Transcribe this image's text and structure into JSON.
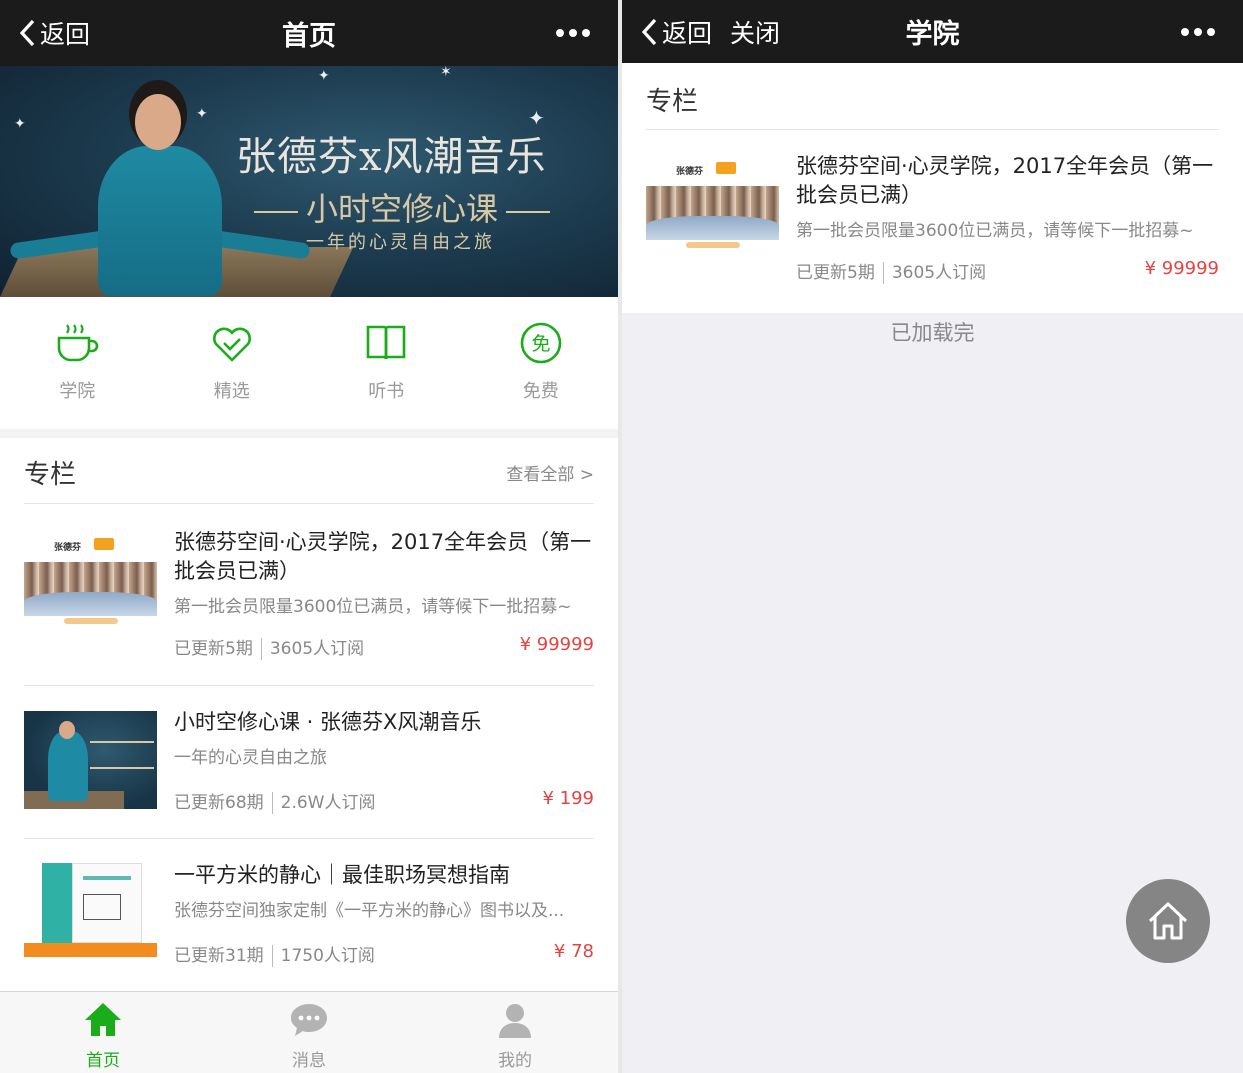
{
  "left": {
    "navbar": {
      "back_label": "返回",
      "title": "首页"
    },
    "banner": {
      "title": "张德芬x风潮音乐",
      "subtitle": "小时空修心课",
      "tagline": "一年的心灵自由之旅"
    },
    "quick_nav": [
      {
        "label": "学院",
        "icon": "teacup-icon"
      },
      {
        "label": "精选",
        "icon": "heart-check-icon"
      },
      {
        "label": "听书",
        "icon": "book-icon"
      },
      {
        "label": "免费",
        "icon": "free-icon",
        "glyph": "免"
      }
    ],
    "section": {
      "title": "专栏",
      "more_label": "查看全部 >",
      "items": [
        {
          "title": "张德芬空间·心灵学院，2017全年会员（第一批会员已满）",
          "desc": "第一批会员限量3600位已满员，请等候下一批招募~",
          "updates": "已更新5期",
          "subscribers": "3605人订阅",
          "price": "¥ 99999"
        },
        {
          "title": "小时空修心课 · 张德芬X风潮音乐",
          "desc": "一年的心灵自由之旅",
          "updates": "已更新68期",
          "subscribers": "2.6W人订阅",
          "price": "¥ 199"
        },
        {
          "title": "一平方米的静心｜最佳职场冥想指南",
          "desc": "张德芬空间独家定制《一平方米的静心》图书以及...",
          "updates": "已更新31期",
          "subscribers": "1750人订阅",
          "price": "¥ 78"
        }
      ]
    },
    "tabbar": [
      {
        "label": "首页",
        "icon": "home-icon",
        "active": true
      },
      {
        "label": "消息",
        "icon": "message-icon",
        "active": false
      },
      {
        "label": "我的",
        "icon": "user-icon",
        "active": false
      }
    ],
    "colors": {
      "accent_green": "#1aad19",
      "price_red": "#e64340",
      "navbar": "#1b1b1b"
    }
  },
  "right": {
    "navbar": {
      "back_label": "返回",
      "close_label": "关闭",
      "title": "学院"
    },
    "section": {
      "title": "专栏",
      "item": {
        "title": "张德芬空间·心灵学院，2017全年会员（第一批会员已满）",
        "desc": "第一批会员限量3600位已满员，请等候下一批招募~",
        "updates": "已更新5期",
        "subscribers": "3605人订阅",
        "price": "¥ 99999"
      }
    },
    "loaded_text": "已加载完",
    "home_button_icon": "home-outline-icon"
  }
}
